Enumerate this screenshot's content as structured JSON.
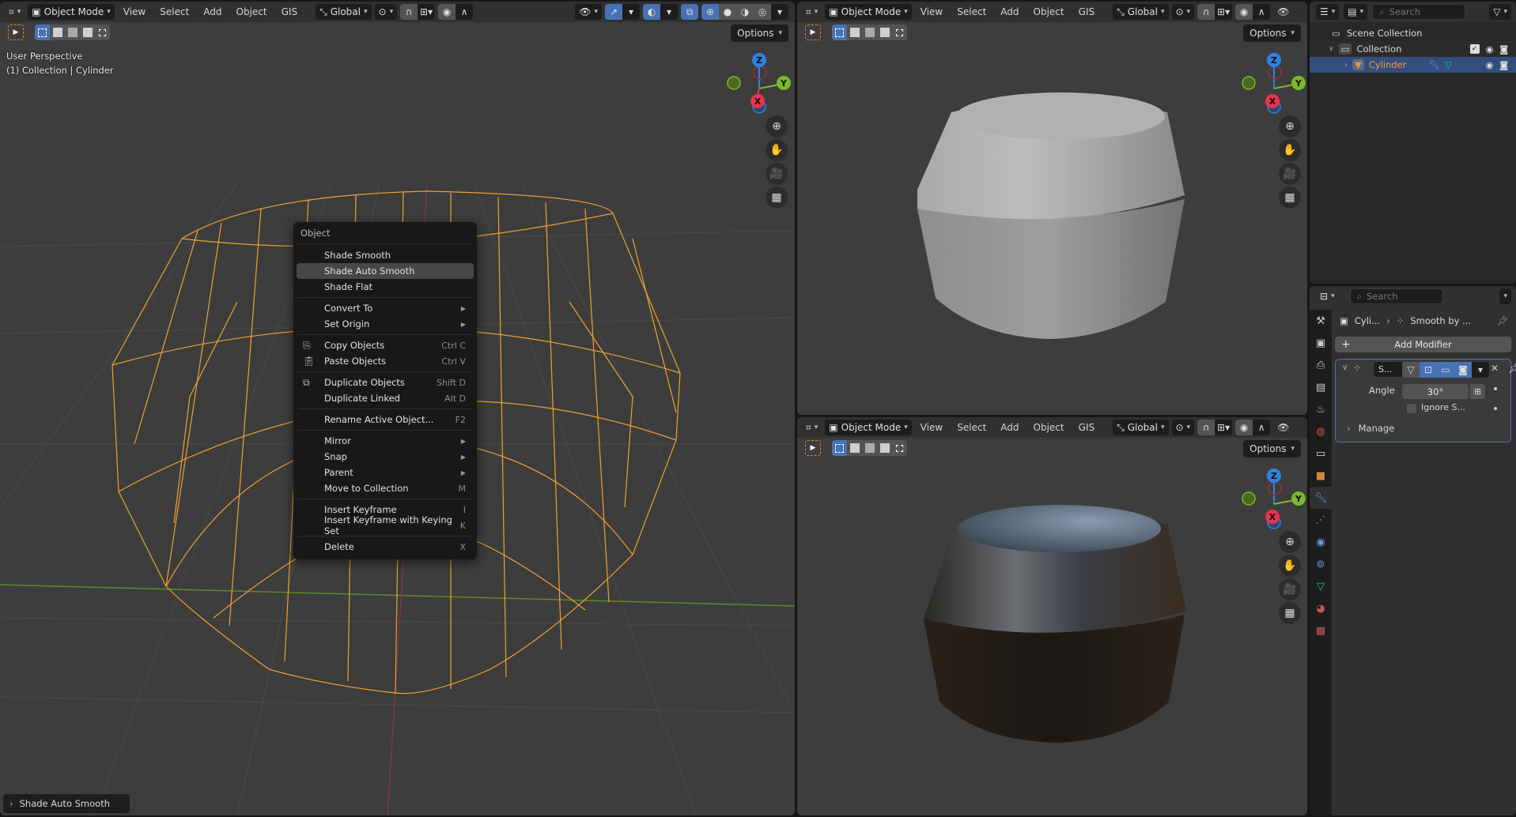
{
  "header": {
    "editor_type_icon": "3d-viewport-icon",
    "mode": "Object Mode",
    "menus": [
      "View",
      "Select",
      "Add",
      "Object",
      "GIS"
    ],
    "orientation": "Global",
    "options_label": "Options"
  },
  "left_viewport": {
    "view_name": "User Perspective",
    "collection_info": "(1) Collection | Cylinder",
    "shading": "wireframe"
  },
  "top_right_viewport": {
    "shading": "solid"
  },
  "bottom_right_viewport": {
    "shading": "material-preview"
  },
  "gizmo": {
    "x": "X",
    "y": "Y",
    "z": "Z"
  },
  "context_menu": {
    "title": "Object",
    "groups": [
      [
        {
          "label": "Shade Smooth",
          "shortcut": "",
          "submenu": false,
          "icon": "",
          "highlighted": false
        },
        {
          "label": "Shade Auto Smooth",
          "shortcut": "",
          "submenu": false,
          "icon": "",
          "highlighted": true
        },
        {
          "label": "Shade Flat",
          "shortcut": "",
          "submenu": false,
          "icon": "",
          "highlighted": false
        }
      ],
      [
        {
          "label": "Convert To",
          "shortcut": "",
          "submenu": true,
          "icon": ""
        },
        {
          "label": "Set Origin",
          "shortcut": "",
          "submenu": true,
          "icon": ""
        }
      ],
      [
        {
          "label": "Copy Objects",
          "shortcut": "Ctrl C",
          "submenu": false,
          "icon": "copy-icon"
        },
        {
          "label": "Paste Objects",
          "shortcut": "Ctrl V",
          "submenu": false,
          "icon": "paste-icon"
        }
      ],
      [
        {
          "label": "Duplicate Objects",
          "shortcut": "Shift D",
          "submenu": false,
          "icon": "duplicate-icon"
        },
        {
          "label": "Duplicate Linked",
          "shortcut": "Alt D",
          "submenu": false,
          "icon": ""
        }
      ],
      [
        {
          "label": "Rename Active Object...",
          "shortcut": "F2",
          "submenu": false,
          "icon": ""
        }
      ],
      [
        {
          "label": "Mirror",
          "shortcut": "",
          "submenu": true,
          "icon": ""
        },
        {
          "label": "Snap",
          "shortcut": "",
          "submenu": true,
          "icon": ""
        },
        {
          "label": "Parent",
          "shortcut": "",
          "submenu": true,
          "icon": ""
        },
        {
          "label": "Move to Collection",
          "shortcut": "M",
          "submenu": false,
          "icon": ""
        }
      ],
      [
        {
          "label": "Insert Keyframe",
          "shortcut": "I",
          "submenu": false,
          "icon": ""
        },
        {
          "label": "Insert Keyframe with Keying Set",
          "shortcut": "K",
          "submenu": false,
          "icon": ""
        }
      ],
      [
        {
          "label": "Delete",
          "shortcut": "X",
          "submenu": false,
          "icon": ""
        }
      ]
    ]
  },
  "last_operator": {
    "label": "Shade Auto Smooth"
  },
  "outliner": {
    "search_placeholder": "Search",
    "rows": [
      {
        "label": "Scene Collection",
        "type": "scene-collection"
      },
      {
        "label": "Collection",
        "type": "collection",
        "checked": true
      },
      {
        "label": "Cylinder",
        "type": "mesh-object",
        "selected": true
      }
    ]
  },
  "properties": {
    "search_placeholder": "Search",
    "breadcrumb": [
      "Cyli...",
      "Smooth by ..."
    ],
    "add_modifier_label": "Add Modifier",
    "modifier": {
      "name": "S...",
      "angle_label": "Angle",
      "angle_value": "30°",
      "ignore_label": "Ignore S...",
      "ignore_checked": false,
      "manage_label": "Manage"
    },
    "tabs": [
      "tool",
      "render",
      "output",
      "view-layer",
      "scene",
      "world",
      "collection",
      "object",
      "modifiers",
      "particles",
      "physics",
      "constraints",
      "data",
      "material",
      "texture"
    ],
    "active_tab": "modifiers"
  },
  "colors": {
    "accent": "#4772b3",
    "selection_orange": "#f5a033",
    "axis_x": "#e8344e",
    "axis_y": "#7ab929",
    "axis_z": "#2f83e0"
  }
}
